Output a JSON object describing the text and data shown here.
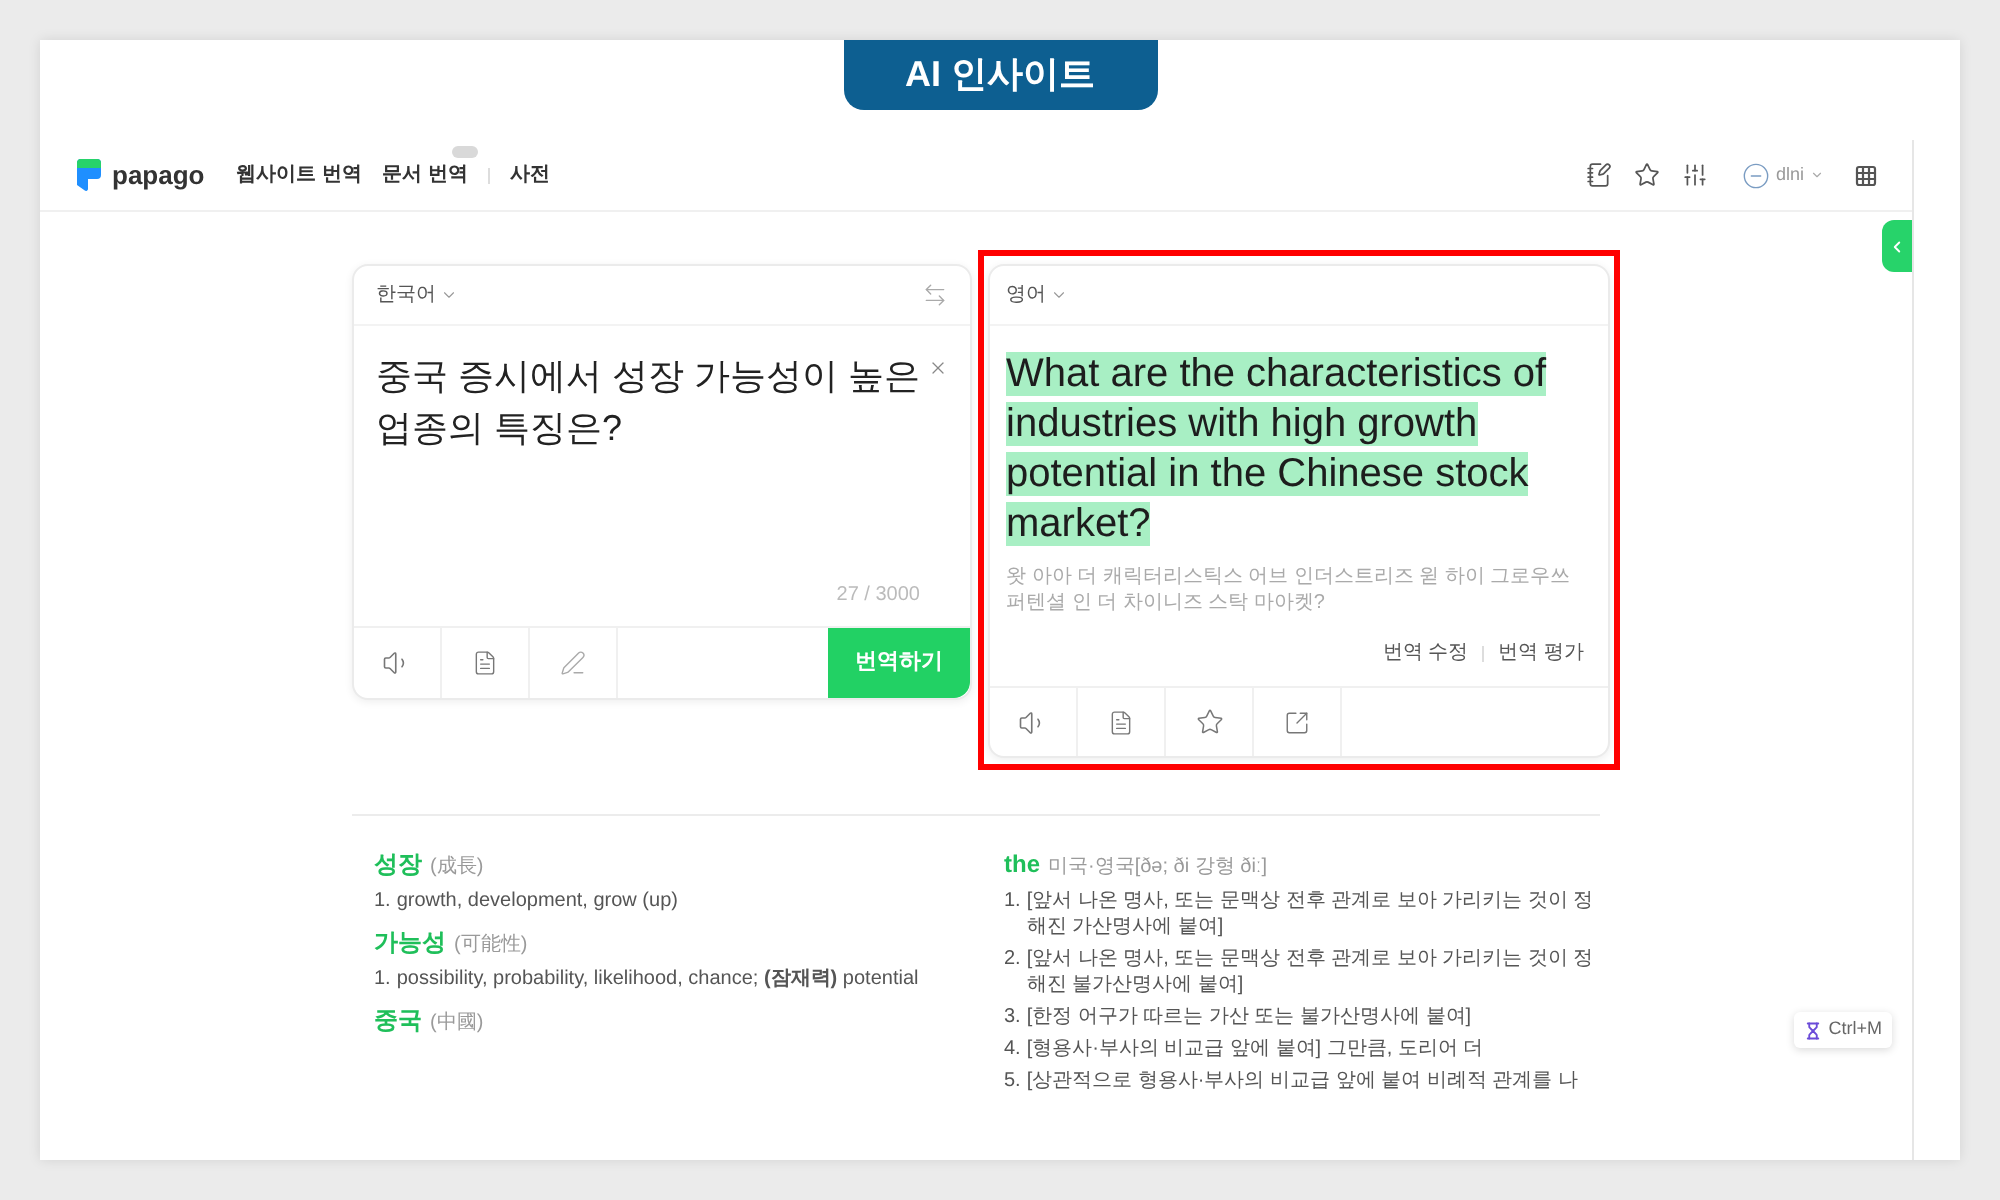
{
  "banner": {
    "title": "AI 인사이트"
  },
  "header": {
    "logo": "papago",
    "nav": [
      {
        "label": "웹사이트 번역",
        "badge": false
      },
      {
        "label": "문서 번역",
        "badge": true
      },
      {
        "label": "사전",
        "badge": false
      }
    ],
    "user": "dlni"
  },
  "source": {
    "language": "한국어",
    "text": "중국 증시에서 성장 가능성이 높은 업종의 특징은?",
    "char_count": "27 / 3000",
    "translate_button": "번역하기"
  },
  "target": {
    "language": "영어",
    "framed": true,
    "translation_selected": true,
    "translation": "What are the characteristics of industries with high growth potential in the Chinese stock market?",
    "pronunciation": "왓 아아 더 캐릭터리스틱스 어브 인더스트리즈 윋 하이 그로우쓰 퍼텐셜 인 더 차이니즈 스탁 마아켓?",
    "actions": [
      "번역 수정",
      "번역 평가"
    ]
  },
  "dictionary": {
    "source_entries": [
      {
        "word": "성장",
        "note": "(成長)",
        "meanings": [
          {
            "number": "1.",
            "text": "growth, development, grow (up)"
          }
        ]
      },
      {
        "word": "가능성",
        "note": "(可能性)",
        "meanings": [
          {
            "number": "1.",
            "text": "possibility, probability, likelihood, chance; **(잠재력)** potential"
          }
        ]
      },
      {
        "word": "중국",
        "note": "(中國)"
      }
    ],
    "target_entries": [
      {
        "word": "the",
        "note": "미국·영국[ðə; ði 강형 ðiː]",
        "meanings": [
          {
            "number": "1.",
            "text": "[앞서 나온 명사, 또는 문맥상 전후 관계로 보아 가리키는 것이 정해진 가산명사에 붙여]"
          },
          {
            "number": "2.",
            "text": "[앞서 나온 명사, 또는 문맥상 전후 관계로 보아 가리키는 것이 정해진 불가산명사에 붙여]"
          },
          {
            "number": "3.",
            "text": "[한정 어구가 따르는 가산 또는 불가산명사에 붙여]"
          },
          {
            "number": "4.",
            "text": "[형용사·부사의 비교급 앞에 붙여] 그만큼, 도리어 더"
          },
          {
            "number": "5.",
            "text": "[상관적으로 형용사·부사의 비교급 앞에 붙여 비례적 관계를 나"
          }
        ]
      }
    ]
  },
  "shortcut_hint": "Ctrl+M"
}
